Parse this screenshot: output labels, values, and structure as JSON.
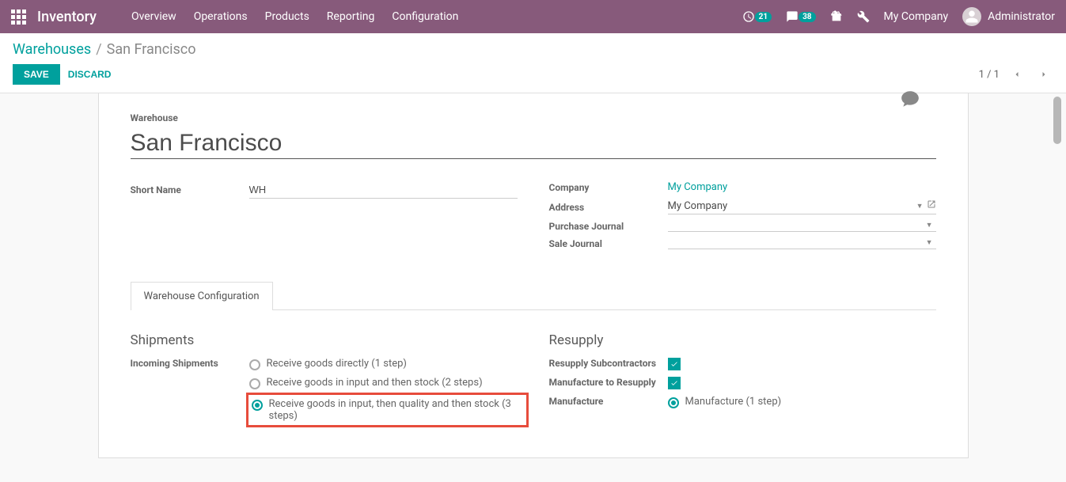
{
  "navbar": {
    "app_title": "Inventory",
    "menu": [
      "Overview",
      "Operations",
      "Products",
      "Reporting",
      "Configuration"
    ],
    "activity_count": "21",
    "message_count": "38",
    "company": "My Company",
    "user": "Administrator"
  },
  "breadcrumb": {
    "parent": "Warehouses",
    "current": "San Francisco"
  },
  "buttons": {
    "save": "SAVE",
    "discard": "DISCARD"
  },
  "pager": {
    "text": "1 / 1"
  },
  "form": {
    "warehouse_label": "Warehouse",
    "warehouse_name": "San Francisco",
    "short_name_label": "Short Name",
    "short_name": "WH",
    "company_label": "Company",
    "company": "My Company",
    "address_label": "Address",
    "address": "My Company",
    "purchase_journal_label": "Purchase Journal",
    "purchase_journal": "",
    "sale_journal_label": "Sale Journal",
    "sale_journal": ""
  },
  "tab": {
    "label": "Warehouse Configuration"
  },
  "shipments": {
    "title": "Shipments",
    "incoming_label": "Incoming Shipments",
    "opt1": "Receive goods directly (1 step)",
    "opt2": "Receive goods in input and then stock (2 steps)",
    "opt3": "Receive goods in input, then quality and then stock (3 steps)"
  },
  "resupply": {
    "title": "Resupply",
    "sub_label": "Resupply Subcontractors",
    "mfg_label": "Manufacture to Resupply",
    "manufacture_label": "Manufacture",
    "manufacture_opt": "Manufacture (1 step)"
  }
}
